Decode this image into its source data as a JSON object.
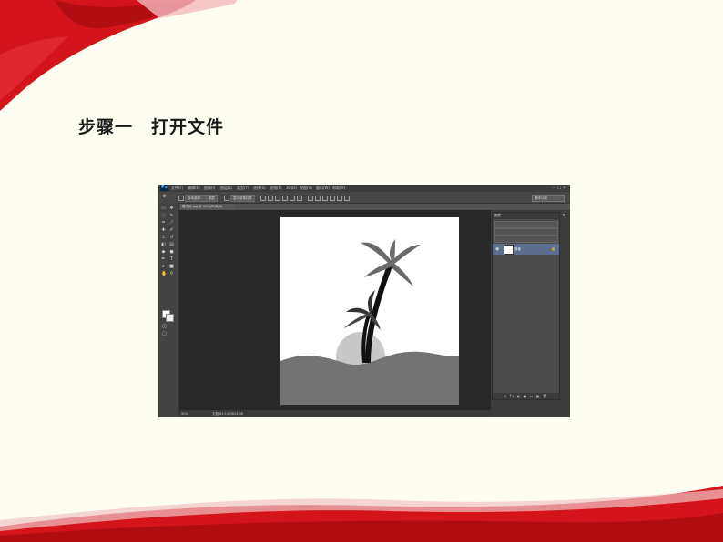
{
  "slide": {
    "title": "步骤一　打开文件"
  },
  "photoshop": {
    "logo": "Ps",
    "menu": [
      "文件(F)",
      "编辑(E)",
      "图像(I)",
      "图层(L)",
      "类型(Y)",
      "选择(S)",
      "滤镜(T)",
      "3D(D)",
      "视图(V)",
      "窗口(W)",
      "帮助(H)"
    ],
    "document_tab": "椰子树.jpg @ 50%(RGB/8)",
    "workspace": "基本功能",
    "status": {
      "zoom": "50%",
      "doc_info": "文档:813.0K/813.0K"
    },
    "layers_panel": {
      "tab_label": "图层",
      "layer_name": "背景"
    },
    "options_bar": {
      "auto_select": "自动选择：",
      "group": "图层",
      "show_transform": "显示变换控件"
    },
    "icons": [
      "move-icon",
      "marquee-icon",
      "lasso-icon",
      "quick-select-icon",
      "crop-icon",
      "eyedropper-icon",
      "healing-icon",
      "brush-icon",
      "stamp-icon",
      "history-brush-icon",
      "eraser-icon",
      "gradient-icon",
      "blur-icon",
      "dodge-icon",
      "pen-icon",
      "type-icon",
      "path-select-icon",
      "shape-icon",
      "hand-icon",
      "zoom-icon"
    ]
  },
  "colors": {
    "ribbon": "#d3141b",
    "slide_bg": "#fefdf2",
    "ps_dark": "#282828",
    "layer_selected": "#5b6e8e"
  }
}
